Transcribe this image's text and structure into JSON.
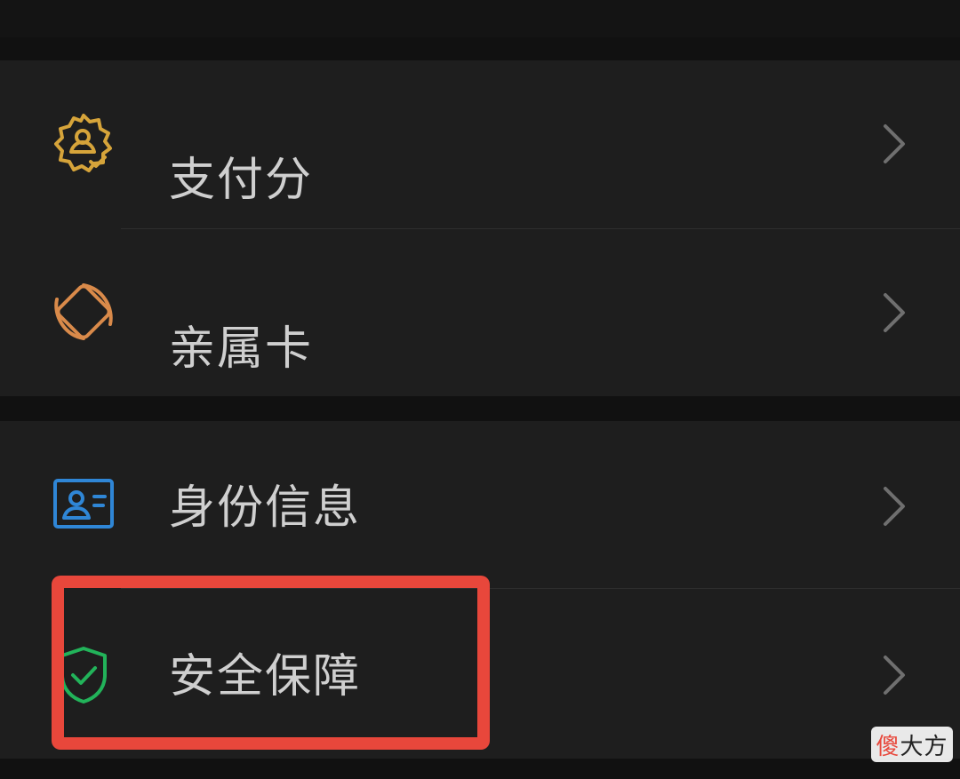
{
  "menu": {
    "groups": [
      {
        "items": [
          {
            "label": "支付分",
            "icon": "badge-person-icon",
            "icon_color": "#d6a43a"
          },
          {
            "label": "亲属卡",
            "icon": "family-card-icon",
            "icon_color": "#d98a4a"
          }
        ]
      },
      {
        "items": [
          {
            "label": "身份信息",
            "icon": "id-card-icon",
            "icon_color": "#2f86d6"
          },
          {
            "label": "安全保障",
            "icon": "shield-check-icon",
            "icon_color": "#22b35a"
          }
        ]
      }
    ],
    "highlight_color": "#e8473b"
  },
  "watermark": {
    "char1": "傻",
    "rest": "大方"
  }
}
